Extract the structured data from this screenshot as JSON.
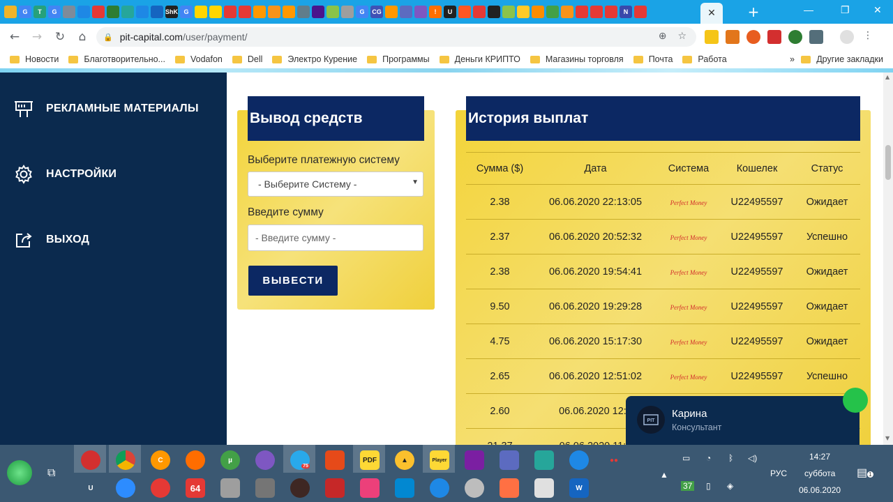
{
  "browser": {
    "url_host": "pit-capital.com",
    "url_path": "/user/payment/",
    "active_tab_close": "✕",
    "new_tab": "+",
    "tab_icons": [
      {
        "label": "",
        "color": "#f0b429"
      },
      {
        "label": "G",
        "color": "#4285f4"
      },
      {
        "label": "T",
        "color": "#26a17b"
      },
      {
        "label": "G",
        "color": "#4285f4"
      },
      {
        "label": "",
        "color": "#7e8b9a"
      },
      {
        "label": "",
        "color": "#1e88e5"
      },
      {
        "label": "",
        "color": "#e53935"
      },
      {
        "label": "",
        "color": "#2e7d32"
      },
      {
        "label": "",
        "color": "#26a69a"
      },
      {
        "label": "",
        "color": "#1e88e5"
      },
      {
        "label": "",
        "color": "#1565c0"
      },
      {
        "label": "ShK",
        "color": "#222222"
      },
      {
        "label": "G",
        "color": "#4285f4"
      },
      {
        "label": "",
        "color": "#ffd600"
      },
      {
        "label": "",
        "color": "#ffd600"
      },
      {
        "label": "",
        "color": "#e53935"
      },
      {
        "label": "",
        "color": "#e53935"
      },
      {
        "label": "",
        "color": "#ff9800"
      },
      {
        "label": "",
        "color": "#f7931a"
      },
      {
        "label": "",
        "color": "#ff9800"
      },
      {
        "label": "",
        "color": "#607d8b"
      },
      {
        "label": "",
        "color": "#4a148c"
      },
      {
        "label": "",
        "color": "#8bc34a"
      },
      {
        "label": "",
        "color": "#9e9e9e"
      },
      {
        "label": "G",
        "color": "#4285f4"
      },
      {
        "label": "CG",
        "color": "#3f51b5"
      },
      {
        "label": "",
        "color": "#ff9800"
      },
      {
        "label": "",
        "color": "#5c6bc0"
      },
      {
        "label": "",
        "color": "#7e57c2"
      },
      {
        "label": "!",
        "color": "#ff6f00"
      },
      {
        "label": "U",
        "color": "#212121"
      },
      {
        "label": "",
        "color": "#ff5722"
      },
      {
        "label": "",
        "color": "#e53935"
      },
      {
        "label": "",
        "color": "#212121"
      },
      {
        "label": "",
        "color": "#8bc34a"
      },
      {
        "label": "",
        "color": "#ffca28"
      },
      {
        "label": "",
        "color": "#fb8c00"
      },
      {
        "label": "",
        "color": "#43a047"
      },
      {
        "label": "",
        "color": "#f7931a"
      },
      {
        "label": "",
        "color": "#e53935"
      },
      {
        "label": "",
        "color": "#e53935"
      },
      {
        "label": "",
        "color": "#e53935"
      },
      {
        "label": "N",
        "color": "#3949ab"
      },
      {
        "label": "",
        "color": "#e53935"
      }
    ],
    "bookmarks": [
      "Новости",
      "Благотворительно...",
      "Vodafon",
      "Dell",
      "Электро Курение",
      "Программы",
      "Деньги КРИПТО",
      "Магазины торговля",
      "Почта",
      "Работа"
    ],
    "bookmarks_more": "»",
    "bookmarks_other": "Другие закладки"
  },
  "sidebar": {
    "items": [
      {
        "label": "РЕКЛАМНЫЕ МАТЕРИАЛЫ",
        "icon": "billboard-icon"
      },
      {
        "label": "НАСТРОЙКИ",
        "icon": "gear-icon"
      },
      {
        "label": "ВЫХОД",
        "icon": "logout-icon"
      }
    ]
  },
  "withdraw": {
    "title": "Вывод средств",
    "system_label": "Выберите платежную систему",
    "system_value": "- Выберите Систему -",
    "amount_label": "Введите сумму",
    "amount_placeholder": "- Введите сумму -",
    "button": "ВЫВЕСТИ"
  },
  "history": {
    "title": "История выплат",
    "columns": [
      "Сумма ($)",
      "Дата",
      "Система",
      "Кошелек",
      "Статус"
    ],
    "system_logo": "Perfect Money",
    "rows": [
      {
        "amount": "2.38",
        "date": "06.06.2020 22:13:05",
        "wallet": "U22495597",
        "status": "Ожидает"
      },
      {
        "amount": "2.37",
        "date": "06.06.2020 20:52:32",
        "wallet": "U22495597",
        "status": "Успешно"
      },
      {
        "amount": "2.38",
        "date": "06.06.2020 19:54:41",
        "wallet": "U22495597",
        "status": "Ожидает"
      },
      {
        "amount": "9.50",
        "date": "06.06.2020 19:29:28",
        "wallet": "U22495597",
        "status": "Ожидает"
      },
      {
        "amount": "4.75",
        "date": "06.06.2020 15:17:30",
        "wallet": "U22495597",
        "status": "Ожидает"
      },
      {
        "amount": "2.65",
        "date": "06.06.2020 12:51:02",
        "wallet": "U22495597",
        "status": "Успешно"
      },
      {
        "amount": "2.60",
        "date": "06.06.2020 12:1",
        "wallet": "",
        "status": ""
      },
      {
        "amount": "21.37",
        "date": "06.06.2020 11:1",
        "wallet": "",
        "status": ""
      }
    ]
  },
  "chat": {
    "name": "Карина",
    "role": "Консультант"
  },
  "taskbar": {
    "lang": "РУС",
    "time": "14:27",
    "weekday": "суббота",
    "date": "06.06.2020",
    "notification_count": "1",
    "badge_37": "37",
    "badge_64": "64",
    "badge_75": "75"
  }
}
